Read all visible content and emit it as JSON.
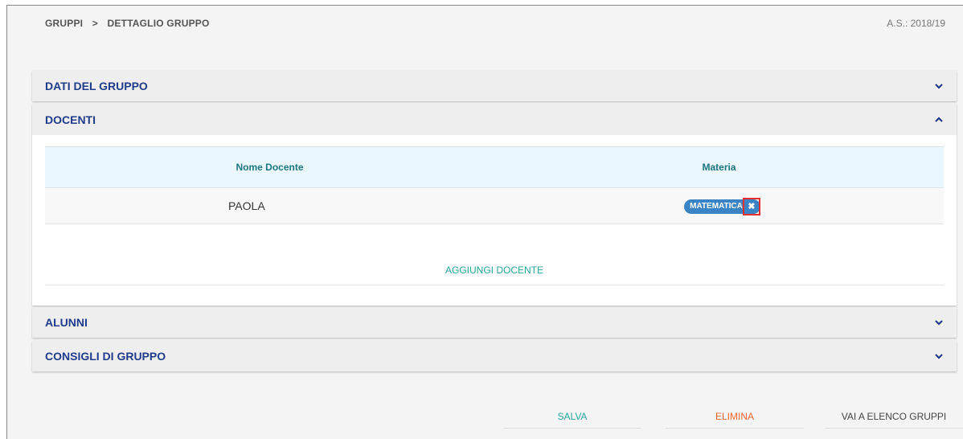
{
  "breadcrumb": {
    "root": "GRUPPI",
    "separator": ">",
    "current": "DETTAGLIO GRUPPO"
  },
  "year": "A.S.: 2018/19",
  "panels": {
    "dati": {
      "title": "DATI DEL GRUPPO",
      "expanded": false,
      "icon": "chevron-down-icon"
    },
    "docenti": {
      "title": "DOCENTI",
      "expanded": true,
      "icon": "chevron-up-icon"
    },
    "alunni": {
      "title": "ALUNNI",
      "expanded": false,
      "icon": "chevron-down-icon"
    },
    "consigli": {
      "title": "CONSIGLI DI GRUPPO",
      "expanded": false,
      "icon": "chevron-down-icon"
    }
  },
  "docenti_table": {
    "headers": [
      "Nome Docente",
      "Materia"
    ],
    "rows": [
      {
        "name": "PAOLA",
        "subject": "MATEMATICA",
        "remove_icon": "close-icon"
      }
    ]
  },
  "add_teacher": "AGGIUNGI DOCENTE",
  "actions": {
    "save": "SALVA",
    "delete": "ELIMINA",
    "go_list": "VAI A ELENCO GRUPPI"
  },
  "colors": {
    "header_text": "#1f3b8a",
    "accent_teal": "#26a69a",
    "danger": "#f0632f",
    "tag": "#3a83c5",
    "highlight": "#e53030"
  }
}
